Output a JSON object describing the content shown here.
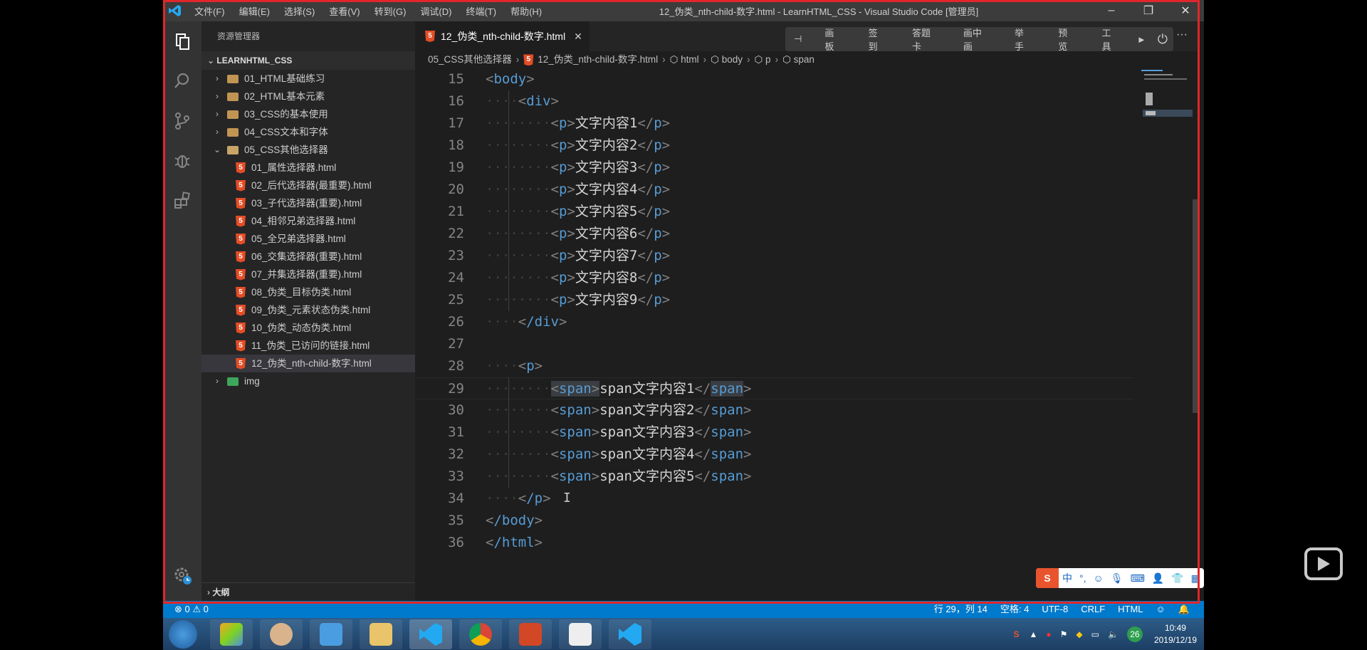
{
  "window": {
    "menu": [
      "文件(F)",
      "编辑(E)",
      "选择(S)",
      "查看(V)",
      "转到(G)",
      "调试(D)",
      "终端(T)",
      "帮助(H)"
    ],
    "title": "12_伪类_nth-child-数字.html - LearnHTML_CSS - Visual Studio Code [管理员]"
  },
  "sidebar": {
    "header": "资源管理器",
    "project": "LEARNHTML_CSS",
    "folders": [
      {
        "label": "01_HTML基础练习"
      },
      {
        "label": "02_HTML基本元素"
      },
      {
        "label": "03_CSS的基本使用"
      },
      {
        "label": "04_CSS文本和字体"
      }
    ],
    "open_folder": "05_CSS其他选择器",
    "files": [
      "01_属性选择器.html",
      "02_后代选择器(最重要).html",
      "03_子代选择器(重要).html",
      "04_相邻兄弟选择器.html",
      "05_全兄弟选择器.html",
      "06_交集选择器(重要).html",
      "07_并集选择器(重要).html",
      "08_伪类_目标伪类.html",
      "09_伪类_元素状态伪类.html",
      "10_伪类_动态伪类.html",
      "11_伪类_已访问的链接.html",
      "12_伪类_nth-child-数字.html"
    ],
    "img_folder": "img",
    "outline": "大纲"
  },
  "editor": {
    "tab": "12_伪类_nth-child-数字.html",
    "toolbar": [
      "画板",
      "签到",
      "答题卡",
      "画中画",
      "举手",
      "预览",
      "工具"
    ],
    "breadcrumb": [
      "05_CSS其他选择器",
      "12_伪类_nth-child-数字.html",
      "html",
      "body",
      "p",
      "span"
    ],
    "lines": [
      {
        "n": "15",
        "indent": "",
        "tag": "body",
        "close": false,
        "text": ""
      },
      {
        "n": "16",
        "indent": "····",
        "tag": "div",
        "close": false,
        "text": ""
      },
      {
        "n": "17",
        "indent": "········",
        "tag": "p",
        "close": true,
        "text": "文字内容1"
      },
      {
        "n": "18",
        "indent": "········",
        "tag": "p",
        "close": true,
        "text": "文字内容2"
      },
      {
        "n": "19",
        "indent": "········",
        "tag": "p",
        "close": true,
        "text": "文字内容3"
      },
      {
        "n": "20",
        "indent": "········",
        "tag": "p",
        "close": true,
        "text": "文字内容4"
      },
      {
        "n": "21",
        "indent": "········",
        "tag": "p",
        "close": true,
        "text": "文字内容5"
      },
      {
        "n": "22",
        "indent": "········",
        "tag": "p",
        "close": true,
        "text": "文字内容6"
      },
      {
        "n": "23",
        "indent": "········",
        "tag": "p",
        "close": true,
        "text": "文字内容7"
      },
      {
        "n": "24",
        "indent": "········",
        "tag": "p",
        "close": true,
        "text": "文字内容8"
      },
      {
        "n": "25",
        "indent": "········",
        "tag": "p",
        "close": true,
        "text": "文字内容9"
      },
      {
        "n": "26",
        "indent": "····",
        "tag": "/div",
        "close": false,
        "text": ""
      },
      {
        "n": "27",
        "indent": "",
        "tag": "",
        "close": false,
        "text": ""
      },
      {
        "n": "28",
        "indent": "····",
        "tag": "p",
        "close": false,
        "text": ""
      },
      {
        "n": "29",
        "indent": "········",
        "tag": "span",
        "close": true,
        "text": "span文字内容1"
      },
      {
        "n": "30",
        "indent": "········",
        "tag": "span",
        "close": true,
        "text": "span文字内容2"
      },
      {
        "n": "31",
        "indent": "········",
        "tag": "span",
        "close": true,
        "text": "span文字内容3"
      },
      {
        "n": "32",
        "indent": "········",
        "tag": "span",
        "close": true,
        "text": "span文字内容4"
      },
      {
        "n": "33",
        "indent": "········",
        "tag": "span",
        "close": true,
        "text": "span文字内容5"
      },
      {
        "n": "34",
        "indent": "····",
        "tag": "/p",
        "close": false,
        "text": ""
      },
      {
        "n": "35",
        "indent": "",
        "tag": "/body",
        "close": false,
        "text": ""
      },
      {
        "n": "36",
        "indent": "",
        "tag": "/html",
        "close": false,
        "text": ""
      }
    ]
  },
  "status": {
    "problems": "0",
    "warnings": "0",
    "position": "行 29，列 14",
    "spaces": "空格: 4",
    "encoding": "UTF-8",
    "eol": "CRLF",
    "language": "HTML"
  },
  "taskbar": {
    "time": "10:49",
    "date": "2019/12/19",
    "badge": "26"
  },
  "ime": {
    "label": "中"
  },
  "colors": {
    "accent": "#007acc",
    "tag": "#569cd6",
    "frame": "#e0262a"
  }
}
